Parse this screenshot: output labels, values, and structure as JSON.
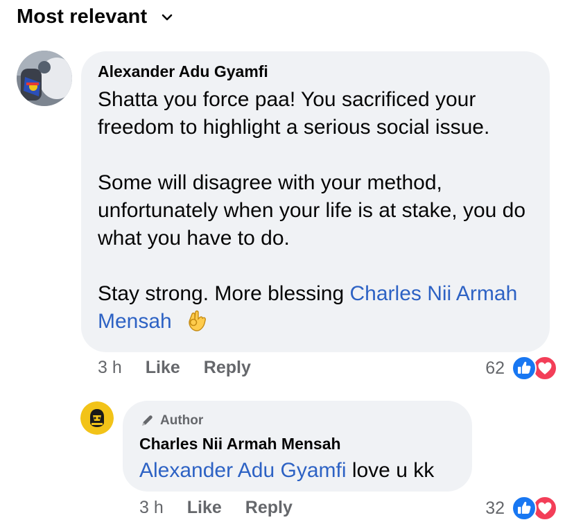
{
  "sort": {
    "label": "Most relevant"
  },
  "comment": {
    "author": "Alexander Adu Gyamfi",
    "paragraphs": [
      "Shatta you force paa! You sacrificed your freedom to highlight a serious social issue.",
      "Some will disagree with your method, unfortunately when your life is at stake, you do what you have to do."
    ],
    "closing_text": "Stay strong. More blessing ",
    "mention": "Charles Nii Armah Mensah",
    "emoji_name": "ok-hand-emoji",
    "time": "3 h",
    "like_label": "Like",
    "reply_label": "Reply",
    "reaction_count": "62"
  },
  "reply": {
    "badge": "Author",
    "author": "Charles Nii Armah Mensah",
    "mention": "Alexander Adu Gyamfi",
    "text": " love u kk",
    "time": "3 h",
    "like_label": "Like",
    "reply_label": "Reply",
    "reaction_count": "32"
  },
  "colors": {
    "bubble_bg": "#f0f2f5",
    "mention": "#2d62c4",
    "like_blue": "#1877f2",
    "love_red": "#f33e58",
    "secondary_text": "#65676b"
  }
}
